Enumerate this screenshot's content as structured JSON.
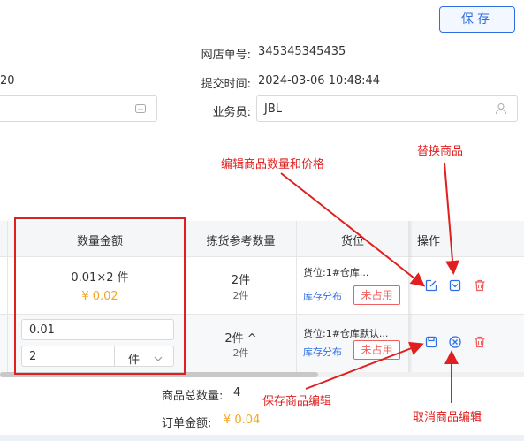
{
  "header": {
    "save_label": "保存"
  },
  "form": {
    "shop_order_label": "网店单号:",
    "shop_order_value": "345345345435",
    "left_partial_value": "20",
    "submit_time_label": "提交时间:",
    "submit_time_value": "2024-03-06 10:48:44",
    "salesman_label": "业务员:",
    "salesman_value": "JBL"
  },
  "table": {
    "headers": {
      "qty_amount": "数量金额",
      "pick_ref_qty": "拣货参考数量",
      "location": "货位",
      "action": "操作"
    },
    "rows": [
      {
        "qty_amount": "0.01×2 件",
        "amount": "¥ 0.02",
        "pick_main": "2件",
        "pick_sub": "2件",
        "location": "货位:1#仓库...",
        "stock_dist": "库存分布",
        "status_tag": "未占用"
      },
      {
        "price_input": "0.01",
        "qty_input": "2",
        "unit_select": "件",
        "pick_main": "2件 ^",
        "pick_sub": "2件",
        "location": "货位:1#仓库默认...",
        "stock_dist": "库存分布",
        "status_tag": "未占用"
      }
    ]
  },
  "summary": {
    "total_qty_label": "商品总数量:",
    "total_qty_value": "4",
    "order_amount_label": "订单金额:",
    "order_amount_value": "¥ 0.04"
  },
  "annotations": {
    "edit_qty_price": "编辑商品数量和价格",
    "replace_item": "替换商品",
    "save_edit": "保存商品编辑",
    "cancel_edit": "取消商品编辑"
  },
  "colors": {
    "accent": "#2f6fe4",
    "annotation_red": "#e02020",
    "amount_orange": "#f5a623",
    "tag_red": "#f06060"
  },
  "icons": [
    "user-icon",
    "input-suffix-icon",
    "edit-icon",
    "replace-icon",
    "trash-icon",
    "save-icon",
    "cancel-icon",
    "chevron-down-icon",
    "chevron-up-icon"
  ]
}
